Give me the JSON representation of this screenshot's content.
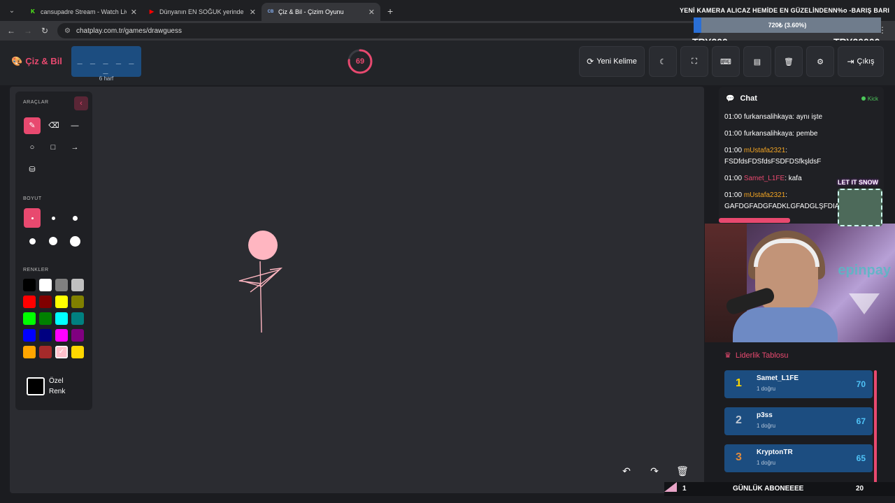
{
  "browser": {
    "tabs": [
      {
        "title": "cansupadre Stream - Watch Liv",
        "favicon": "K",
        "favicon_color": "#53fc18",
        "active": false
      },
      {
        "title": "Dünyanın EN SOĞUK yerinde B",
        "favicon": "▶",
        "favicon_color": "#ff0000",
        "active": false
      },
      {
        "title": "Çiz & Bil - Çizim Oyunu",
        "favicon": "CB",
        "favicon_color": "#8ab4f8",
        "active": true
      }
    ],
    "url": "chatplay.com.tr/games/drawguess"
  },
  "overlay": {
    "ticker": "YENİ KAMERA ALICAZ HEMİDE EN GÜZELİNDENN%o -BARIŞ BARI",
    "goal_text": "720₺ (3.60%)",
    "goal_progress": 0.036,
    "goal_min": "TRY200",
    "goal_max": "TRY20000",
    "bottom_left": "1",
    "bottom_label": "GÜNLÜK ABONEEEE",
    "bottom_right": "20",
    "snow_label": "LET IT SNOW",
    "cam_brand": "epinpay"
  },
  "header": {
    "logo": "Çiz & Bil",
    "word_dashes": "_ _ _ _ _ _",
    "word_length": "6 harf",
    "timer": "69",
    "timer_fraction": 0.77,
    "buttons": {
      "new_word": "Yeni Kelime",
      "exit": "Çıkış"
    }
  },
  "tools": {
    "section_tools": "ARAÇLAR",
    "section_size": "BOYUT",
    "section_colors": "RENKLER",
    "custom_color_line1": "Özel",
    "custom_color_line2": "Renk",
    "colors": [
      "#000000",
      "#ffffff",
      "#808080",
      "#c0c0c0",
      "#ff0000",
      "#800000",
      "#ffff00",
      "#808000",
      "#00ff00",
      "#008000",
      "#00ffff",
      "#008080",
      "#0000ff",
      "#000080",
      "#ff00ff",
      "#800080",
      "#ffa500",
      "#a52a2a",
      "#ffc0cb",
      "#ffd700"
    ],
    "selected_color_index": 18
  },
  "chat": {
    "title": "Chat",
    "status": "Kick",
    "messages": [
      {
        "time": "01:00",
        "user": "furkansalihkaya",
        "user_color": "#ffffff",
        "text": "aynı işte"
      },
      {
        "time": "01:00",
        "user": "furkansalihkaya",
        "user_color": "#ffffff",
        "text": "pembe"
      },
      {
        "time": "01:00",
        "user": "mUstafa2321",
        "user_color": "#f5a623",
        "text": "FSDfdsFDSfdsFSDFDSfkşldsF"
      },
      {
        "time": "01:00",
        "user": "Samet_L1FE",
        "user_color": "#e8496f",
        "text": "kafa"
      },
      {
        "time": "01:00",
        "user": "mUstafa2321",
        "user_color": "#f5a623",
        "text": "GAFDGFADGFADKLGFADGLŞFDIAGI"
      }
    ]
  },
  "leaderboard": {
    "title": "Liderlik Tablosu",
    "rows": [
      {
        "rank": "1",
        "name": "Samet_L1FE",
        "sub": "1 doğru",
        "score": "70",
        "rank_color": "#ffd700"
      },
      {
        "rank": "2",
        "name": "p3ss",
        "sub": "1 doğru",
        "score": "67",
        "rank_color": "#c0c8d2"
      },
      {
        "rank": "3",
        "name": "KryptonTR",
        "sub": "1 doğru",
        "score": "65",
        "rank_color": "#e08a3c"
      }
    ]
  }
}
